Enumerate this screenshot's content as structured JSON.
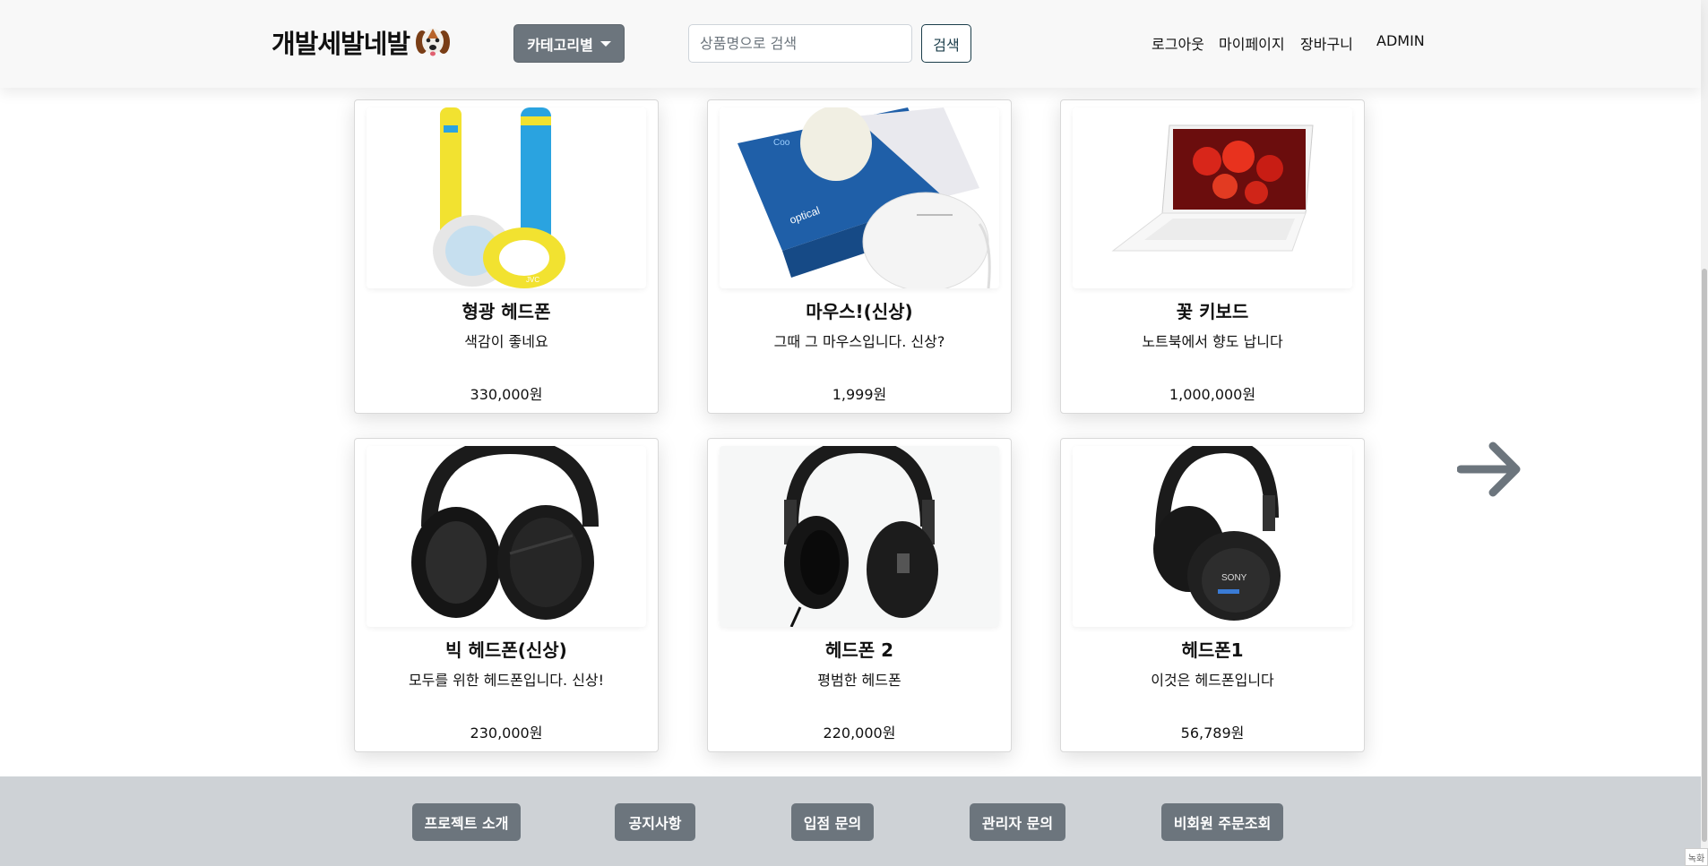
{
  "header": {
    "logo_text": "개발세발네발",
    "category_button": "카테고리별",
    "search_placeholder": "상품명으로 검색",
    "search_button": "검색",
    "nav": {
      "logout": "로그아웃",
      "mypage": "마이페이지",
      "cart": "장바구니",
      "admin": "ADMIN"
    }
  },
  "products": [
    {
      "name": "형광 헤드폰",
      "desc": "색감이 좋네요",
      "price": "330,000원",
      "image": "headphones-yellow-blue"
    },
    {
      "name": "마우스!(신상)",
      "desc": "그때 그 마우스입니다. 신상?",
      "price": "1,999원",
      "image": "mouse-with-box"
    },
    {
      "name": "꽃 키보드",
      "desc": "노트북에서 향도 납니다",
      "price": "1,000,000원",
      "image": "laptop-flowers"
    },
    {
      "name": "빅 헤드폰(신상)",
      "desc": "모두를 위한 헤드폰입니다. 신상!",
      "price": "230,000원",
      "image": "headphones-black"
    },
    {
      "name": "헤드폰 2",
      "desc": "평범한 헤드폰",
      "price": "220,000원",
      "image": "headphones-black"
    },
    {
      "name": "헤드폰1",
      "desc": "이것은 헤드폰입니다",
      "price": "56,789원",
      "image": "headphones-black-sony"
    }
  ],
  "footer": {
    "project_intro": "프로젝트 소개",
    "notice": "공지사항",
    "vendor_inquiry": "입점 문의",
    "admin_inquiry": "관리자 문의",
    "guest_order_lookup": "비회원 주문조회"
  },
  "corner_tag": "녹화",
  "colors": {
    "header_bg": "#f8f8f8",
    "button_gray": "#6c757d",
    "footer_bg": "#ced2d6",
    "search_btn_border": "#1b3d4a",
    "arrow": "#6c757d"
  },
  "icons": {
    "logo": "beagle-dog-icon",
    "category_caret": "caret-down-icon",
    "next": "arrow-right-icon"
  }
}
